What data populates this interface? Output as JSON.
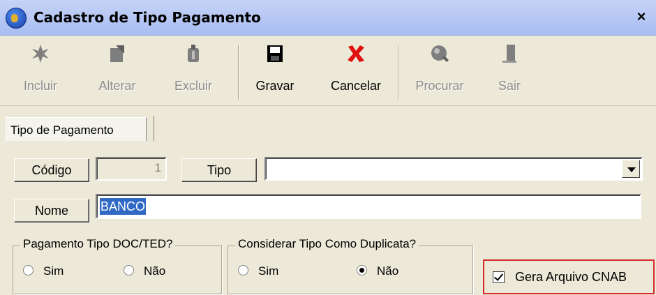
{
  "window": {
    "title": "Cadastro de Tipo Pagamento",
    "close": "×"
  },
  "toolbar": {
    "incluir": "Incluir",
    "alterar": "Alterar",
    "excluir": "Excluir",
    "gravar": "Gravar",
    "cancelar": "Cancelar",
    "procurar": "Procurar",
    "sair": "Sair"
  },
  "tabs": [
    {
      "label": "Tipo de Pagamento"
    }
  ],
  "form": {
    "codigo_label": "Código",
    "codigo_value": "1",
    "tipo_label": "Tipo",
    "tipo_value": "",
    "nome_label": "Nome",
    "nome_value": "BANCO"
  },
  "group_doc_ted": {
    "title": "Pagamento Tipo DOC/TED?",
    "sim": "Sim",
    "nao": "Não",
    "selected": ""
  },
  "group_duplicata": {
    "title": "Considerar Tipo Como Duplicata?",
    "sim": "Sim",
    "nao": "Não",
    "selected": "Não"
  },
  "cnab": {
    "label": "Gera Arquivo CNAB",
    "checked": true
  },
  "colors": {
    "title_bar": "#b7c8f4",
    "window_bg": "#ece9d8",
    "selection": "#316ac5",
    "highlight_border": "#d52b2b"
  }
}
